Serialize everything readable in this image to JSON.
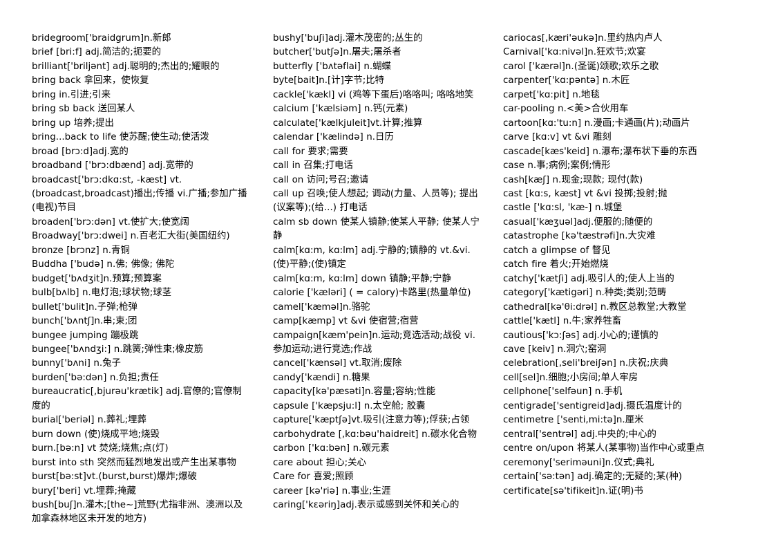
{
  "document": {
    "type": "vocabulary-word-list",
    "page_background": "#ffffff",
    "text_color": "#000000",
    "column_count": 3
  },
  "columns": [
    {
      "name": "column-1",
      "entries": [
        "bridegroom['braidgrum]n.新郎",
        "brief [bri:f] adj.简洁的;扼要的",
        "brilliant['briljənt] adj.聪明的;杰出的;耀眼的",
        "bring back 拿回来，使恢复",
        "bring in.引进;引来",
        "bring sb back 送回某人",
        "bring up 培养;提出",
        "bring...back to life 使苏醒;使生动;使活泼",
        "broad [brɔ:d]adj.宽的",
        "broadband ['brɔ:dbænd] adj.宽带的",
        "broadcast['brɔ:dkɑ:st, -kæst] vt.(broadcast,broadcast)播出;传播 vi.广播;参加广播(电视)节目",
        "broaden['brɔ:dən] vt.使扩大;使宽阔",
        "Broadway['brɔ:dwei] n.百老汇大街(美国纽约)",
        "bronze [brɔnz] n.青铜",
        "Buddha ['budə] n.佛; 佛像; 佛陀",
        "budget['bʌdʒit]n.预算;预算案",
        "bulb[bʌlb] n.电灯泡;球状物;球茎",
        "bullet['bulit]n.子弹;枪弹",
        "bunch['bʌntʃ]n.串;束;团",
        "bungee jumping 蹦极跳",
        "bungee['bʌndʒi:] n.跳簧;弹性束;橡皮筋",
        "bunny['bʌni] n.兔子",
        "burden['bə:dən] n.负担;责任",
        "bureaucratic[,bjurəu'krætik] adj.官僚的;官僚制度的",
        "burial['beriəl] n.葬礼;埋葬",
        "burn down (使)烧成平地;烧毁",
        "burn.[bə:n] vt 焚烧;烧焦;点(灯)",
        "burst into sth 突然而猛烈地发出或产生出某事物",
        "burst[bə:st]vt.(burst,burst)爆炸;爆破",
        "bury['beri] vt.埋葬;掩藏",
        "bush[buʃ]n.灌木;[the~]荒野(尤指非洲、澳洲以及加拿森林地区未开发的地方)"
      ]
    },
    {
      "name": "column-2",
      "entries": [
        "bushy['buʃi]adj.灌木茂密的;丛生的",
        "butcher['butʃə]n.屠夫;屠杀者",
        "butterfly ['bʌtəflai] n.蝴蝶",
        "byte[bait]n.[计]字节;比特",
        "cackle['kækl] vi (鸡等下蛋后)咯咯叫; 咯咯地笑",
        "calcium ['kælsiəm] n.钙(元素)",
        "calculate['kælkjuleit]vt.计算;推算",
        "calendar ['kælində] n.日历",
        "call for 要求;需要",
        "call in 召集;打电话",
        "call on 访问;号召;邀请",
        "call up 召唤;使人想起; 调动(力量、人员等); 提出(议案等);(给...) 打电话",
        "calm sb down 使某人镇静;使某人平静; 使某人宁静",
        "calm[kɑ:m, kɑ:lm] adj.宁静的;镇静的 vt.&vi.(使)平静;(使)镇定",
        "calm[kɑ:m, kɑ:lm] down 镇静;平静;宁静",
        "calorie ['kæləri] ( = calory)卡路里(热量单位)",
        "camel['kæməl]n.骆驼",
        "camp[kæmp] vt &vi 使宿营;宿营",
        "campaign[kæm'pein]n.运动;竞选活动;战役 vi.参加运动;进行竞选;作战",
        "cancel['kænsəl] vt.取消;废除",
        "candy['kændi] n.糖果",
        "capacity[kə'pæsəti]n.容量;容纳;性能",
        "capsule ['kæpsju:l] n.太空舱; 胶囊",
        "capture['kæptʃə]vt.吸引(注意力等);俘获;占领",
        "carbohydrate [,kɑ:bəu'haidreit] n.碳水化合物",
        "carbon ['kɑ:bən] n.碳元素",
        "care about 担心;关心",
        "Care for 喜爱;照顾",
        "career [kə'riə] n.事业;生涯",
        "caring['kɛəriŋ]adj.表示或感到关怀和关心的"
      ]
    },
    {
      "name": "column-3",
      "entries": [
        "cariocas[,kæri'əukə]n.里约热内卢人",
        "Carnival['kɑ:nivəl]n.狂欢节;欢宴",
        "carol ['kærəl]n.(圣诞)颂歌;欢乐之歌",
        "carpenter['kɑ:pəntə] n.木匠",
        "carpet['kɑ:pit] n.地毯",
        "car-pooling n.<美>合伙用车",
        "cartoon[kɑ:'tu:n] n.漫画;卡通画(片);动画片",
        "carve [kɑ:v] vt &vi 雕刻",
        "cascade[kæs'keid] n.瀑布;瀑布状下垂的东西",
        "case n.事;病例;案例;情形",
        "cash[kæʃ] n.现金;现款; 现付(款)",
        "cast [kɑ:s, kæst] vt &vi 投掷;投射;抛",
        "castle ['kɑ:sl, 'kæ-] n.城堡",
        "casual['kæʒuəl]adj.便服的;随便的",
        "catastrophe [kə'tæstrəfi]n.大灾难",
        "catch a glimpse of 瞥见",
        "catch fire 着火;开始燃烧",
        "catchy['kætʃi] adj.吸引人的;使人上当的",
        "category['kætigəri] n.种类;类别;范畴",
        "cathedral[kə'θi:drəl] n.教区总教堂;大教堂",
        "cattle['kætl] n.牛;家养牲畜",
        "cautious['kɔ:ʃəs] adj.小心的;谨慎的",
        "cave [keiv] n.洞穴;窑洞",
        "celebration[,seli'breiʃən] n.庆祝;庆典",
        "cell[sel]n.细胞;小房间;单人牢房",
        "cellphone['selfəun] n.手机",
        "centigrade['sentigreid]adj.摄氏温度计的",
        "centimetre ['senti,mi:tə]n.厘米",
        "central['sentrəl] adj.中央的;中心的",
        "centre on/upon 将某人(某事物)当作中心或重点",
        "ceremony['seriməuni]n.仪式;典礼",
        "certain['sə:tən] adj.确定的;无疑的;某(种)",
        "certificate[sə'tifikeit]n.证(明)书"
      ]
    }
  ]
}
